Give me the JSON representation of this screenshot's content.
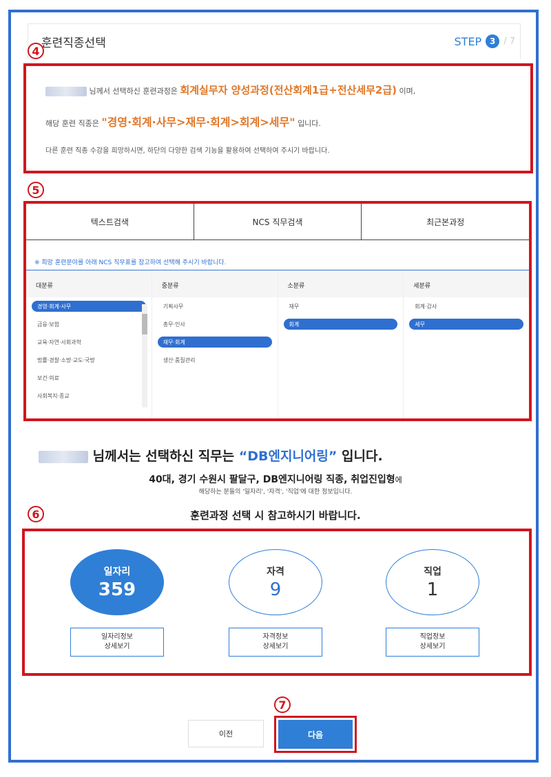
{
  "header": {
    "title": "훈련직종선택",
    "step_label": "STEP",
    "step_number": "3",
    "step_total": "/ 7"
  },
  "markers": {
    "m4": "4",
    "m5": "5",
    "m6": "6",
    "m7": "7"
  },
  "section4": {
    "line1_prefix": "님께서 선택하신 훈련과정은 ",
    "course_name": "회계실무자 양성과정(전산회계1급+전산세무2급)",
    "line1_suffix": "이며,",
    "line2_prefix": "해당 훈련 직종은 ",
    "job_path": "\"경영·회계·사무>재무·회계>회계>세무\"",
    "line2_suffix": "입니다.",
    "line3": "다른 훈련 직종 수강을 희망하시면, 하단의 다양한 검색 기능을 활용하여 선택하여 주시기 바랍니다."
  },
  "section5": {
    "tabs": [
      {
        "label": "텍스트검색"
      },
      {
        "label": "NCS 직무검색"
      },
      {
        "label": "최근본과정"
      }
    ],
    "notice": "※ 희망 훈련분야를 아래 NCS 직무표를 참고하여 선택해 주시기 바랍니다.",
    "columns": [
      {
        "header": "대분류",
        "items": [
          "경영·회계·사무",
          "금융·보험",
          "교육·자연·사회과학",
          "법률·경찰·소방·교도·국방",
          "보건·의료",
          "사회복지·종교"
        ]
      },
      {
        "header": "중분류",
        "items": [
          "기획사무",
          "총무·인사",
          "재무·회계",
          "생산·품질관리"
        ]
      },
      {
        "header": "소분류",
        "items": [
          "재무",
          "회계"
        ]
      },
      {
        "header": "세분류",
        "items": [
          "회계·감사",
          "세무"
        ]
      }
    ]
  },
  "middle": {
    "msg1_prefix": "님께서는 선택하신 직무는 ",
    "msg1_job": "“DB엔지니어링”",
    "msg1_suffix": " 입니다.",
    "msg2_main": "40대, 경기 수원시 팔달구, DB엔지니어링 직종, 취업진입형",
    "msg2_light": "에",
    "msg3": "해당하는 분들의 '일자리', '자격', '직업'에 대한 정보입니다.",
    "msg4": "훈련과정 선택 시 참고하시기 바랍니다."
  },
  "section6": {
    "stats": [
      {
        "label": "일자리",
        "value": "359",
        "button_line1": "일자리정보",
        "button_line2": "상세보기"
      },
      {
        "label": "자격",
        "value": "9",
        "button_line1": "자격정보",
        "button_line2": "상세보기"
      },
      {
        "label": "직업",
        "value": "1",
        "button_line1": "직업정보",
        "button_line2": "상세보기"
      }
    ]
  },
  "footer": {
    "prev_label": "이전",
    "next_label": "다음"
  },
  "colors": {
    "primary_blue": "#2f7fd6",
    "annotation_red": "#d0161e",
    "highlight_orange": "#e0782a"
  }
}
